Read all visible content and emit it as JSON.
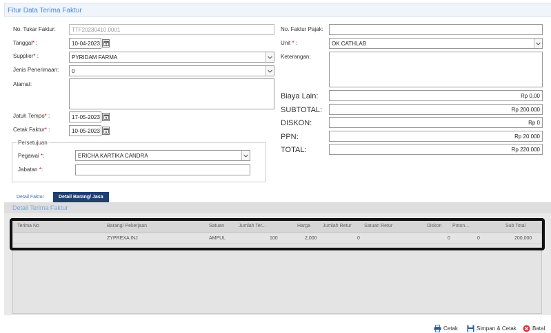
{
  "title": "Fitur Data Terima Faktur",
  "form": {
    "no_tukar_label": "No. Tukar Faktur:",
    "no_tukar_value": "TTF20230410.0001",
    "tanggal_label": "Tanggal",
    "tanggal_value": "10-04-2023",
    "supplier_label": "Supplier",
    "supplier_value": "PYRIDAM FARMA",
    "jenis_label": "Jenis Penerimaan:",
    "jenis_value": "0",
    "alamat_label": "Alamat:",
    "jatuh_label": "Jatuh Tempo",
    "jatuh_value": "17-05-2023",
    "cetak_label": "Cetak Faktur",
    "cetak_value": "10-05-2023",
    "no_pajak_label": "No. Faktur Pajak:",
    "no_pajak_value": "",
    "unit_label": "Unit",
    "unit_value": "OK CATHLAB",
    "keterangan_label": "Keterangan:"
  },
  "persetujuan": {
    "legend": "Persetujuan",
    "pegawai_label": "Pegawai",
    "pegawai_value": "ERICHA KARTIKA CANDRA",
    "jabatan_label": "Jabatan",
    "jabatan_value": ""
  },
  "totals": {
    "biaya_label": "Biaya Lain:",
    "biaya_value": "Rp 0,00",
    "subtotal_label": "SUBTOTAL:",
    "subtotal_value": "Rp 200.000",
    "diskon_label": "DISKON:",
    "diskon_value": "Rp 0",
    "ppn_label": "PPN:",
    "ppn_value": "Rp 20.000",
    "total_label": "TOTAL:",
    "total_value": "Rp 220.000"
  },
  "tabs": {
    "detail_faktur": "Detail Faktur",
    "detail_barang": "Detail Barang/ Jasa"
  },
  "detail_title": "Detail Terima Faktur",
  "grid": {
    "headers": {
      "terima_no": "Terima No",
      "barang": "Barang/ Pekerjaan",
      "satuan": "Satuan",
      "jumlah_ter": "Jumlah Ter...",
      "harga": "Harga",
      "jumlah_retur": "Jumlah Retur",
      "satuan_retur": "Satuan Retur",
      "diskon": "Diskon",
      "poton": "Poton...",
      "subtotal": "Sub Total"
    },
    "row": {
      "terima_no": "",
      "barang": "ZYPREXA INJ",
      "satuan": "AMPUL",
      "jumlah_ter": "100",
      "harga": "2,000",
      "jumlah_retur": "0",
      "satuan_retur": "",
      "diskon": "0",
      "poton": "0",
      "subtotal": "200,000"
    }
  },
  "buttons": {
    "cetak": "Cetak",
    "simpan": "Simpan & Cetak",
    "batal": "Batal"
  },
  "colors": {
    "accent": "#4a8ad0",
    "tab_active": "#1f3f70",
    "batal": "#d83a3a"
  }
}
